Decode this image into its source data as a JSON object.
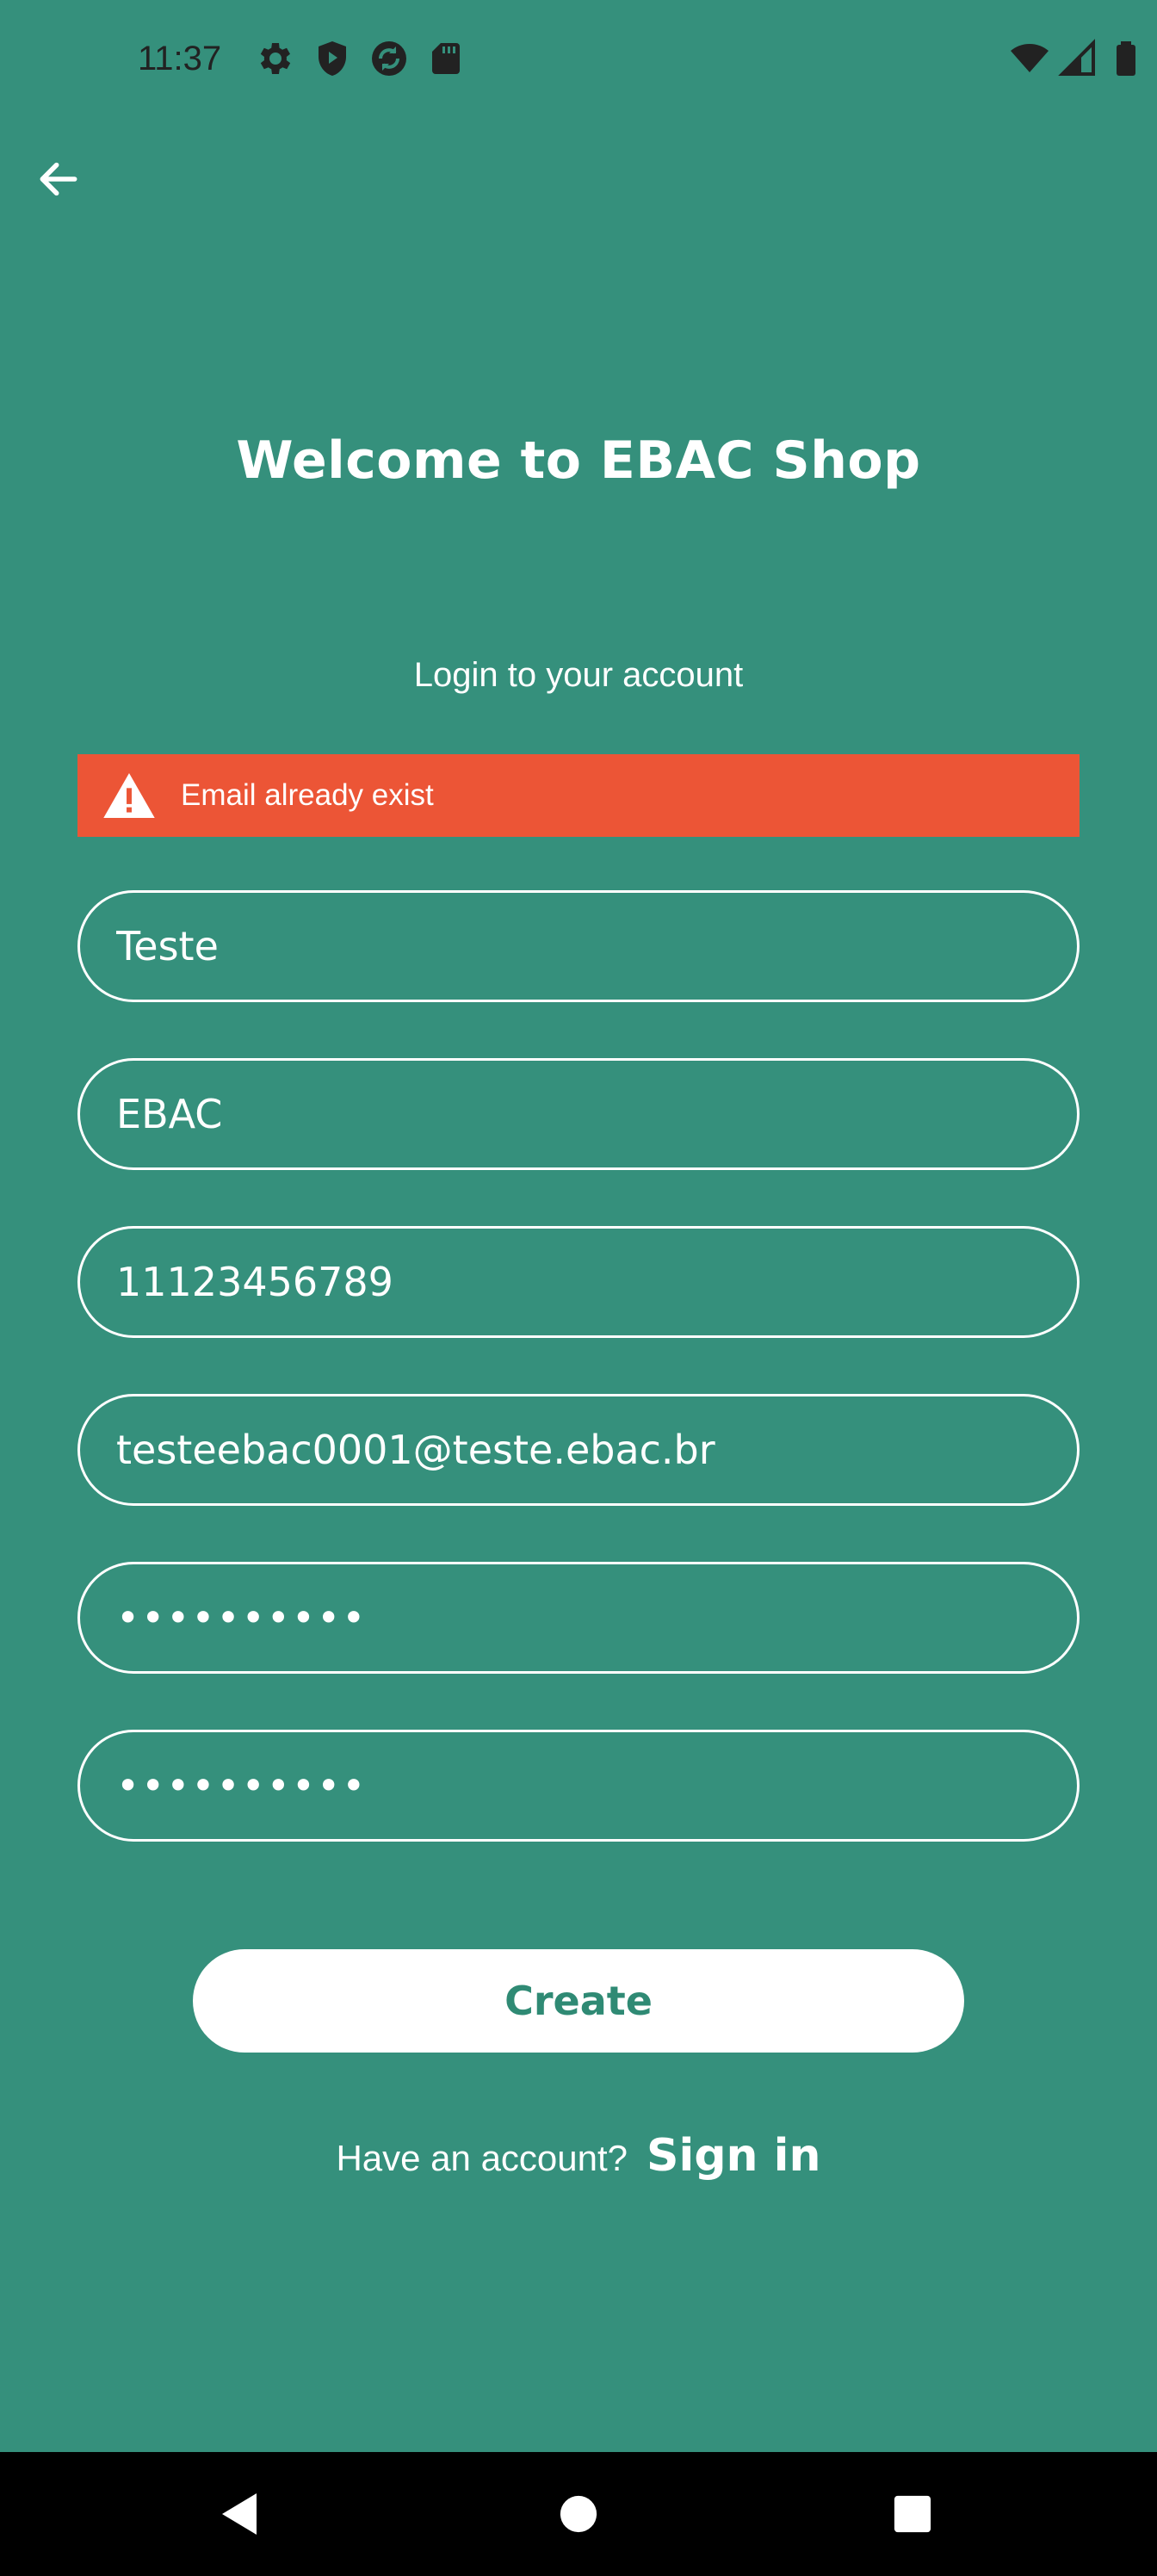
{
  "status_bar": {
    "time": "11:37",
    "left_icons": [
      "settings-icon",
      "shield-icon",
      "sync-icon",
      "sd-card-icon"
    ],
    "right_icons": [
      "wifi-icon",
      "signal-icon",
      "battery-icon"
    ]
  },
  "header": {
    "back_icon": "arrow-left-icon"
  },
  "main": {
    "title": "Welcome to EBAC Shop",
    "subtitle": "Login to your account",
    "error": {
      "icon": "warning-icon",
      "message": "Email already exist",
      "color": "#ec5536"
    },
    "fields": {
      "first_name": "Teste",
      "last_name": "EBAC",
      "phone": "11123456789",
      "email": "testeebac0001@teste.ebac.br",
      "password": "••••••••••",
      "confirm_password": "••••••••••"
    },
    "create_label": "Create",
    "have_account_text": "Have an account?",
    "signin_label": "Sign in"
  },
  "nav_bar": {
    "icons": [
      "back-triangle-icon",
      "home-circle-icon",
      "recents-square-icon"
    ]
  },
  "colors": {
    "background": "#35907c",
    "accent_text": "#2f8a74",
    "error": "#ec5536"
  }
}
